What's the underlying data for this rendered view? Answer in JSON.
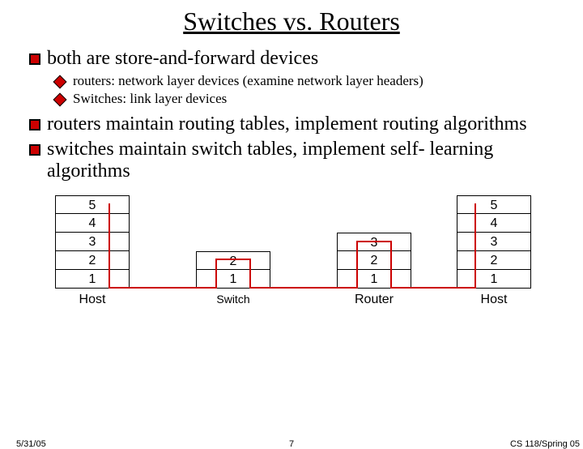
{
  "title": "Switches vs. Routers",
  "bullets": {
    "b1": "both are store-and-forward devices",
    "b1_sub1": "routers: network layer devices (examine network layer headers)",
    "b1_sub2": "Switches: link layer devices",
    "b2": "routers maintain routing tables, implement routing algorithms",
    "b3": "switches maintain switch tables, implement self- learning algorithms"
  },
  "diagram": {
    "layer5": "5",
    "layer4": "4",
    "layer3": "3",
    "layer2": "2",
    "layer1": "1",
    "labels": {
      "host_left": "Host",
      "switch": "Switch",
      "router": "Router",
      "host_right": "Host"
    }
  },
  "footer": {
    "date": "5/31/05",
    "page": "7",
    "course": "CS 118/Spring 05"
  }
}
